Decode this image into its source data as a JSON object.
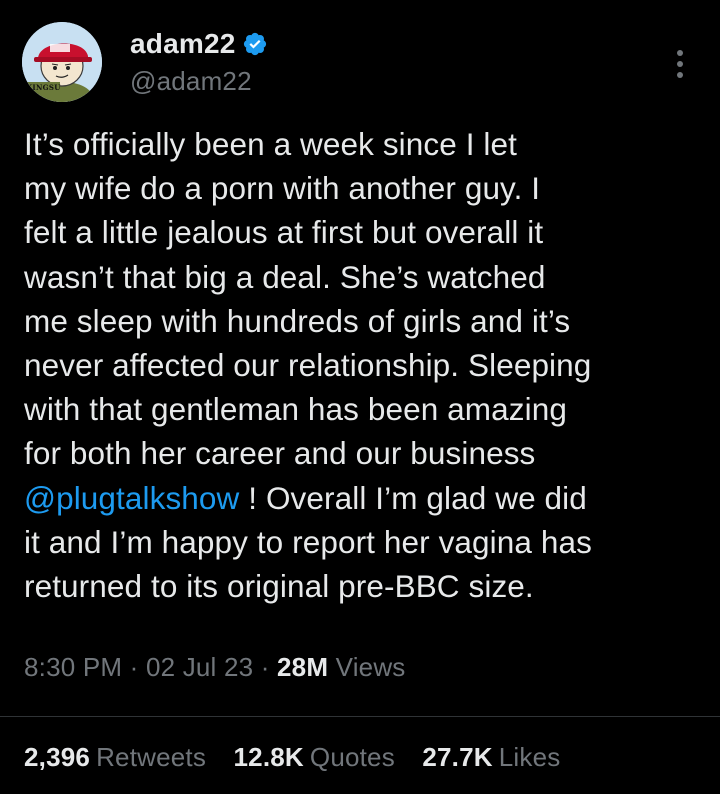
{
  "author": {
    "display_name": "adam22",
    "handle": "@adam22",
    "verified_icon": "verified-badge-icon",
    "avatar_text": "KINGSU"
  },
  "menu_icon": "more-options-icon",
  "tweet": {
    "lines": [
      {
        "text": "It’s officially been a week since I let"
      },
      {
        "text": "my wife do a porn with another guy. I"
      },
      {
        "text": "felt a little jealous at first but overall it"
      },
      {
        "text": "wasn’t that big a deal. She’s watched"
      },
      {
        "text": "me sleep with hundreds of girls and it’s"
      },
      {
        "text": "never affected our relationship. Sleeping"
      },
      {
        "text": "with that gentleman has been amazing"
      },
      {
        "text": "for both her career and our business"
      },
      {
        "mention": "@plugtalkshow",
        "rest": " ! Overall I’m glad we did"
      },
      {
        "text": "it and I’m happy to report her vagina has"
      },
      {
        "text": "returned to its original pre-BBC size."
      }
    ]
  },
  "meta": {
    "time": "8:30 PM",
    "sep1": " · ",
    "date": "02 Jul 23",
    "sep2": " · ",
    "views_count": "28M",
    "views_label": "Views"
  },
  "stats": {
    "retweets_count": "2,396",
    "retweets_label": "Retweets",
    "quotes_count": "12.8K",
    "quotes_label": "Quotes",
    "likes_count": "27.7K",
    "likes_label": "Likes"
  },
  "colors": {
    "background": "#000000",
    "text": "#e7e9ea",
    "secondary": "#71767b",
    "accent": "#1d9bf0",
    "divider": "#2f3336"
  }
}
